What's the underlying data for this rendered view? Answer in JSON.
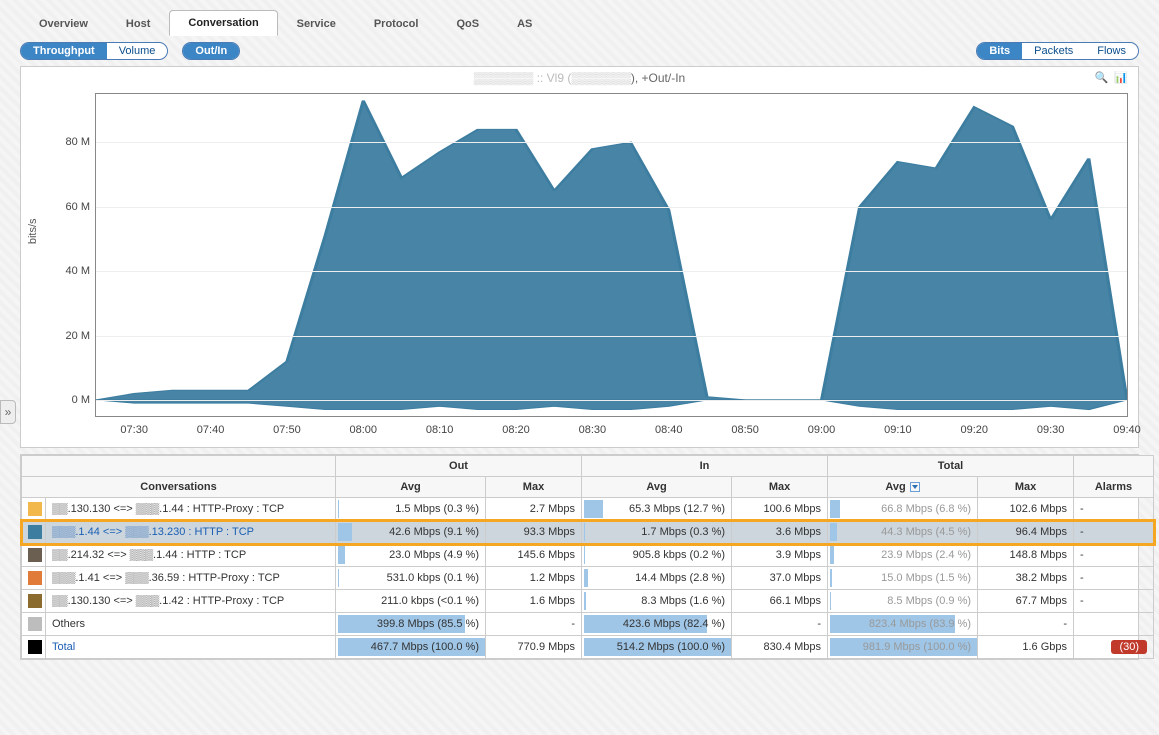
{
  "tabs": [
    "Overview",
    "Host",
    "Conversation",
    "Service",
    "Protocol",
    "QoS",
    "AS"
  ],
  "active_tab": "Conversation",
  "toggles": {
    "metric": {
      "options": [
        "Throughput",
        "Volume"
      ],
      "active": "Throughput"
    },
    "direction": {
      "options": [
        "Out/In"
      ],
      "active": "Out/In"
    },
    "unit": {
      "options": [
        "Bits",
        "Packets",
        "Flows"
      ],
      "active": "Bits"
    }
  },
  "chart_title_prefix": "▒▒▒▒▒▒▒ :: Vl9 (",
  "chart_title_mid": "▒▒▒▒▒▒▒",
  "chart_title_suffix": "), +Out/-In",
  "y_axis_label": "bits/s",
  "chart_data": {
    "type": "area",
    "xlabel": "",
    "ylabel": "bits/s",
    "ylim": [
      -5,
      95
    ],
    "x": [
      "07:25",
      "07:30",
      "07:35",
      "07:40",
      "07:45",
      "07:50",
      "07:55",
      "08:00",
      "08:05",
      "08:10",
      "08:15",
      "08:20",
      "08:25",
      "08:30",
      "08:35",
      "08:40",
      "08:45",
      "08:50",
      "08:55",
      "09:00",
      "09:05",
      "09:10",
      "09:15",
      "09:20",
      "09:25",
      "09:30",
      "09:35",
      "09:40"
    ],
    "series": [
      {
        "name": "Out",
        "color": "#3d7da0",
        "values": [
          0,
          2,
          3,
          3,
          3,
          12,
          51,
          93,
          69,
          77,
          84,
          84,
          65,
          78,
          80,
          59,
          1,
          0,
          0,
          0,
          60,
          74,
          72,
          91,
          85,
          56,
          75,
          0
        ]
      },
      {
        "name": "In",
        "color": "#3d7da0",
        "values": [
          0,
          -1,
          -1,
          -1,
          -1,
          -2,
          -3,
          -3,
          -3,
          -2,
          -3,
          -3,
          -2,
          -3,
          -3,
          -2,
          0,
          0,
          0,
          0,
          -2,
          -3,
          -3,
          -3,
          -3,
          -2,
          -3,
          0
        ]
      }
    ],
    "y_ticks": [
      0,
      20,
      40,
      60,
      80
    ],
    "y_tick_labels": [
      "0 M",
      "20 M",
      "40 M",
      "60 M",
      "80 M"
    ],
    "x_ticks": [
      "07:30",
      "07:40",
      "07:50",
      "08:00",
      "08:10",
      "08:20",
      "08:30",
      "08:40",
      "08:50",
      "09:00",
      "09:10",
      "09:20",
      "09:30",
      "09:40"
    ]
  },
  "table": {
    "group_headers": [
      "",
      "Out",
      "In",
      "Total",
      ""
    ],
    "col_headers": [
      "Conversations",
      "Avg",
      "Max",
      "Avg",
      "Max",
      "Avg",
      "Max",
      "Alarms"
    ],
    "sorted_col_index": 5,
    "rows": [
      {
        "swatch": "#f2b84b",
        "conv": "▒▒.130.130 <=> ▒▒▒.1.44 : HTTP-Proxy : TCP",
        "out_avg": "1.5 Mbps (0.3 %)",
        "out_avg_bar": 0.3,
        "out_max": "2.7 Mbps",
        "in_avg": "65.3 Mbps (12.7 %)",
        "in_avg_bar": 12.7,
        "in_max": "100.6 Mbps",
        "tot_avg": "66.8 Mbps (6.8 %)",
        "tot_avg_bar": 6.8,
        "tot_avg_grey": true,
        "tot_max": "102.6 Mbps",
        "alarm": "-"
      },
      {
        "swatch": "#3d7da0",
        "conv": "▒▒▒.1.44 <=> ▒▒▒.13.230 : HTTP : TCP",
        "link": true,
        "highlight": true,
        "out_avg": "42.6 Mbps (9.1 %)",
        "out_avg_bar": 9.1,
        "out_max": "93.3 Mbps",
        "in_avg": "1.7 Mbps (0.3 %)",
        "in_avg_bar": 0.3,
        "in_max": "3.6 Mbps",
        "tot_avg": "44.3 Mbps (4.5 %)",
        "tot_avg_bar": 4.5,
        "tot_avg_grey": true,
        "tot_max": "96.4 Mbps",
        "alarm": "-"
      },
      {
        "swatch": "#6b5f52",
        "conv": "▒▒.214.32 <=> ▒▒▒.1.44 : HTTP : TCP",
        "out_avg": "23.0 Mbps (4.9 %)",
        "out_avg_bar": 4.9,
        "out_max": "145.6 Mbps",
        "in_avg": "905.8 kbps (0.2 %)",
        "in_avg_bar": 0.2,
        "in_max": "3.9 Mbps",
        "tot_avg": "23.9 Mbps (2.4 %)",
        "tot_avg_bar": 2.4,
        "tot_avg_grey": true,
        "tot_max": "148.8 Mbps",
        "alarm": "-"
      },
      {
        "swatch": "#e07b3a",
        "conv": "▒▒▒.1.41 <=> ▒▒▒.36.59 : HTTP-Proxy : TCP",
        "out_avg": "531.0 kbps (0.1 %)",
        "out_avg_bar": 0.1,
        "out_max": "1.2 Mbps",
        "in_avg": "14.4 Mbps (2.8 %)",
        "in_avg_bar": 2.8,
        "in_max": "37.0 Mbps",
        "tot_avg": "15.0 Mbps (1.5 %)",
        "tot_avg_bar": 1.5,
        "tot_avg_grey": true,
        "tot_max": "38.2 Mbps",
        "alarm": "-"
      },
      {
        "swatch": "#8c6b2e",
        "conv": "▒▒.130.130 <=> ▒▒▒.1.42 : HTTP-Proxy : TCP",
        "out_avg": "211.0 kbps (<0.1 %)",
        "out_avg_bar": 0.05,
        "out_max": "1.6 Mbps",
        "in_avg": "8.3 Mbps (1.6 %)",
        "in_avg_bar": 1.6,
        "in_max": "66.1 Mbps",
        "tot_avg": "8.5 Mbps (0.9 %)",
        "tot_avg_bar": 0.9,
        "tot_avg_grey": true,
        "tot_max": "67.7 Mbps",
        "alarm": "-"
      },
      {
        "swatch": "#bdbdbd",
        "conv": "Others",
        "out_avg": "399.8 Mbps (85.5 %)",
        "out_avg_bar": 85.5,
        "out_max": "-",
        "in_avg": "423.6 Mbps (82.4 %)",
        "in_avg_bar": 82.4,
        "in_max": "-",
        "tot_avg": "823.4 Mbps (83.9 %)",
        "tot_avg_bar": 83.9,
        "tot_avg_grey": true,
        "tot_max": "-",
        "alarm": ""
      },
      {
        "swatch": "#000000",
        "conv": "Total",
        "link": true,
        "out_avg": "467.7 Mbps (100.0 %)",
        "out_avg_bar": 100,
        "out_max": "770.9 Mbps",
        "in_avg": "514.2 Mbps (100.0 %)",
        "in_avg_bar": 100,
        "in_max": "830.4 Mbps",
        "tot_avg": "981.9 Mbps (100.0 %)",
        "tot_avg_bar": 100,
        "tot_avg_grey": true,
        "tot_max": "1.6 Gbps",
        "alarm_badge": "(30)"
      }
    ]
  },
  "expand_glyph": "»"
}
